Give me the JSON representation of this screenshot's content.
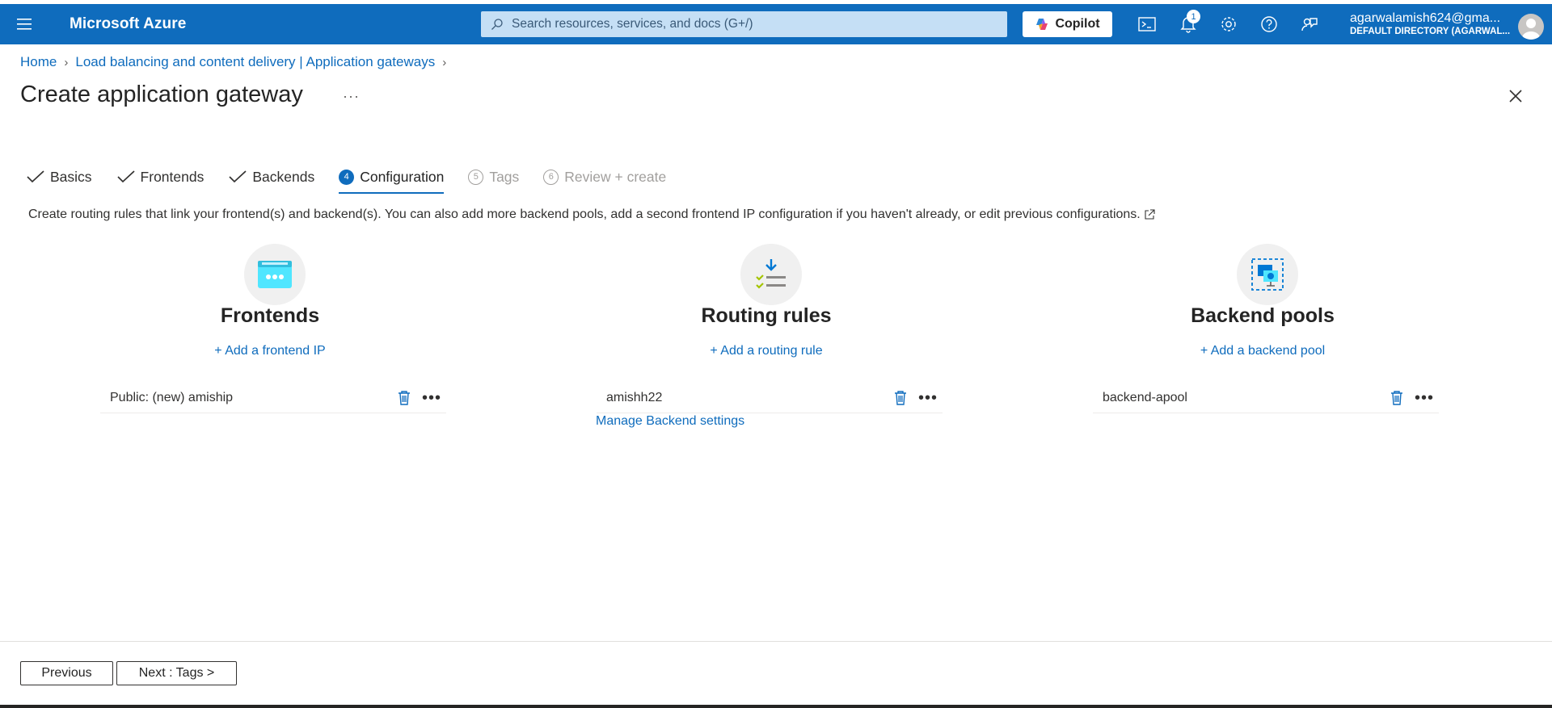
{
  "topbar": {
    "brand": "Microsoft Azure",
    "search_placeholder": "Search resources, services, and docs (G+/)",
    "copilot_label": "Copilot",
    "notification_count": "1",
    "account_email": "agarwalamish624@gma...",
    "account_directory": "DEFAULT DIRECTORY (AGARWAL..."
  },
  "breadcrumb": {
    "home": "Home",
    "parent": "Load balancing and content delivery | Application gateways"
  },
  "page": {
    "title": "Create application gateway",
    "more": "···"
  },
  "tabs": [
    {
      "label": "Basics",
      "state": "done"
    },
    {
      "label": "Frontends",
      "state": "done"
    },
    {
      "label": "Backends",
      "state": "done"
    },
    {
      "label": "Configuration",
      "number": "4",
      "state": "active"
    },
    {
      "label": "Tags",
      "number": "5",
      "state": "disabled"
    },
    {
      "label": "Review + create",
      "number": "6",
      "state": "disabled"
    }
  ],
  "description": "Create routing rules that link your frontend(s) and backend(s). You can also add more backend pools, add a second frontend IP configuration if you haven't already, or edit previous configurations.",
  "columns": {
    "frontends": {
      "heading": "Frontends",
      "add": "+ Add a frontend IP",
      "item": "Public: (new) amiship"
    },
    "routing": {
      "heading": "Routing rules",
      "add": "+ Add a routing rule",
      "item": "amishh22",
      "manage": "Manage Backend settings"
    },
    "backends": {
      "heading": "Backend pools",
      "add": "+ Add a backend pool",
      "item": "backend-apool"
    }
  },
  "footer": {
    "previous": "Previous",
    "next": "Next : Tags >"
  },
  "colors": {
    "accent": "#0f6cbd",
    "topbar": "#0f6cbd"
  }
}
